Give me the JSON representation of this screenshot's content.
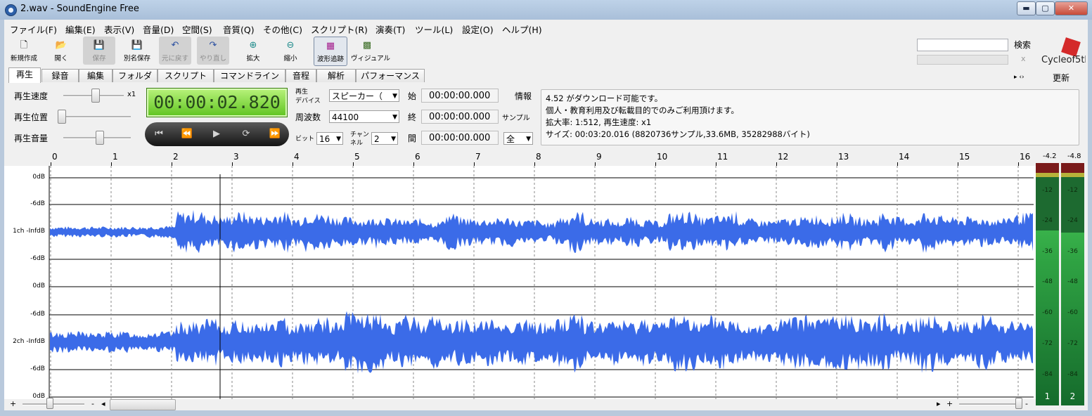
{
  "window": {
    "title": "2.wav - SoundEngine Free",
    "min": "▬",
    "max": "▢",
    "close": "✕"
  },
  "menu": [
    "ファイル(F)",
    "編集(E)",
    "表示(V)",
    "音量(D)",
    "空間(S)",
    "音質(Q)",
    "その他(C)",
    "スクリプト(R)",
    "演奏(T)",
    "ツール(L)",
    "設定(O)",
    "ヘルプ(H)"
  ],
  "toolbar": [
    {
      "label": "新規作成",
      "icon": "new-file-icon",
      "glyph": "🗋"
    },
    {
      "label": "開く",
      "icon": "open-folder-icon",
      "glyph": "📂"
    },
    {
      "label": "保存",
      "icon": "save-icon",
      "glyph": "💾"
    },
    {
      "label": "別名保存",
      "icon": "save-as-icon",
      "glyph": "💾"
    },
    {
      "label": "元に戻す",
      "icon": "undo-icon",
      "glyph": "↶"
    },
    {
      "label": "やり直し",
      "icon": "redo-icon",
      "glyph": "↷"
    },
    {
      "label": "拡大",
      "icon": "zoom-in-icon",
      "glyph": "⊕"
    },
    {
      "label": "縮小",
      "icon": "zoom-out-icon",
      "glyph": "⊖"
    },
    {
      "label": "波形追跡",
      "icon": "waveform-follow-icon",
      "glyph": "▦"
    },
    {
      "label": "ヴィジュアル",
      "icon": "visual-icon",
      "glyph": "▩"
    }
  ],
  "search": {
    "button": "検索",
    "close": "x"
  },
  "logo": {
    "text": "Cycleof5th",
    "accent": "#d42a2a"
  },
  "tabs": [
    "再生",
    "録音",
    "編集",
    "フォルダ",
    "スクリプト",
    "コマンドライン",
    "音程",
    "解析",
    "パフォーマンス"
  ],
  "update_button": "更新",
  "tab_arrows": "▸ ‹›",
  "playback": {
    "speed_label": "再生速度",
    "speed_value": "x1",
    "position_label": "再生位置",
    "volume_label": "再生音量",
    "time": "00:00:02.820",
    "controls": {
      "first": "⏮",
      "rewind": "⏪",
      "play": "▶",
      "loop": "⟳",
      "forward": "⏩"
    }
  },
  "device": {
    "device_label_1": "再生",
    "device_label_2": "デバイス",
    "device_value": "スピーカー（",
    "freq_label": "周波数",
    "freq_value": "44100",
    "bit_label": "ビット",
    "bit_value": "16",
    "channel_label_1": "チャン",
    "channel_label_2": "ネル",
    "channel_value": "2"
  },
  "range": {
    "start_label": "始",
    "start_value": "00:00:00.000",
    "end_label": "終",
    "end_value": "00:00:00.000",
    "dur_label": "間",
    "dur_value": "00:00:00.000",
    "info_label": "情報",
    "unit_label": "サンプル",
    "all_value": "全"
  },
  "info": [
    "4.52 がダウンロード可能です。",
    "個人・教育利用及び転載目的でのみご利用頂けます。",
    "拡大率: 1:512, 再生速度: x1",
    "サイズ: 00:03:20.016 (8820736サンプル,33.6MB, 35282988バイト)"
  ],
  "ruler": [
    "0",
    "1",
    "2",
    "3",
    "4",
    "5",
    "6",
    "7",
    "8",
    "9",
    "10",
    "11",
    "12",
    "13",
    "14",
    "15",
    "16"
  ],
  "db_labels": [
    "0dB",
    "-6dB",
    "1ch -InfdB",
    "-6dB",
    "0dB",
    "-6dB",
    "2ch -InfdB",
    "-6dB",
    "0dB"
  ],
  "meters": {
    "top_left": "-4.2",
    "top_right": "-4.8",
    "ticks": [
      "-12",
      "-24",
      "-36",
      "-48",
      "-60",
      "-72",
      "-84"
    ],
    "ch1": "1",
    "ch2": "2",
    "level_left": 0.78,
    "level_right": 0.77
  },
  "bottom": {
    "plus": "+",
    "minus": "-",
    "left_arrow": "◂",
    "right_arrow": "▸",
    "plus2": "+",
    "minus2": "-"
  },
  "colors": {
    "wave": "#3b6be8",
    "display": "#5ec31f",
    "meter": "#1c8a3a"
  }
}
